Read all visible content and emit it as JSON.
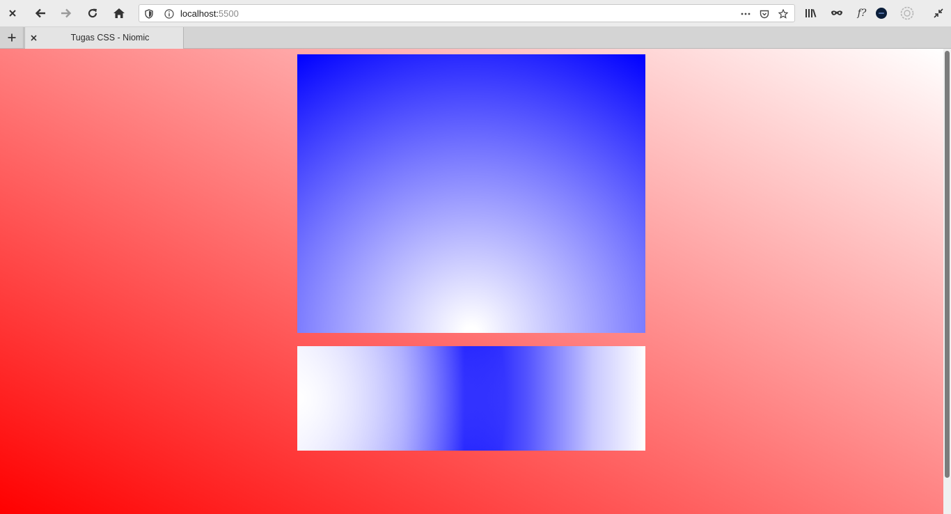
{
  "toolbar": {
    "url_host": "localhost:",
    "url_port": "5500",
    "fx_label": "f?"
  },
  "tabs": [
    {
      "title": "Tugas CSS - Niomic"
    }
  ],
  "colors": {
    "page_gradient": [
      "#ff0000",
      "#ffffff"
    ],
    "box_blue": "#0000ff",
    "box_white": "#ffffff"
  },
  "icons": {
    "toolbar": [
      "close-icon",
      "back-icon",
      "forward-icon",
      "reload-icon",
      "home-icon",
      "shield-icon",
      "info-icon",
      "more-icon",
      "pocket-icon",
      "star-icon",
      "library-icon",
      "mask-icon",
      "fx-icon",
      "profile-icon",
      "settings-icon",
      "collapse-icon"
    ],
    "tabstrip": [
      "plus-icon",
      "tab-close-icon"
    ]
  }
}
